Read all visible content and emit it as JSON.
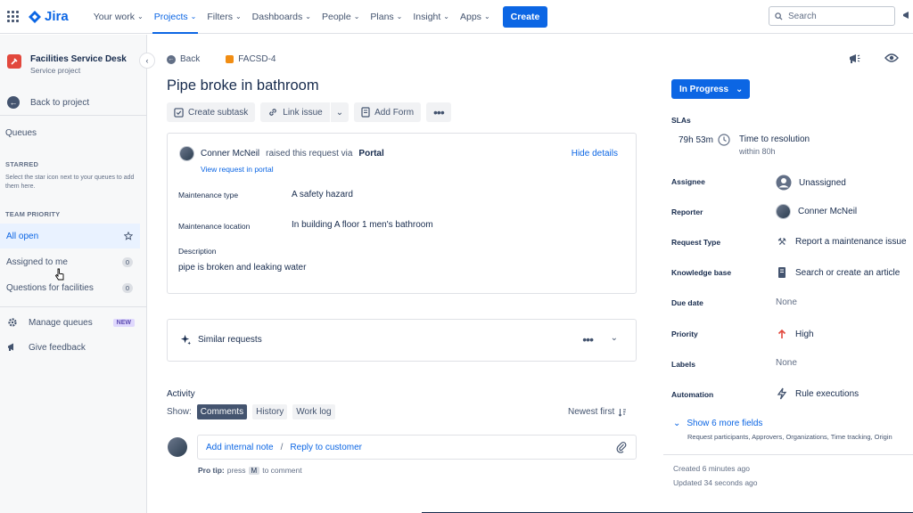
{
  "topnav": {
    "product": "Jira",
    "items": [
      {
        "label": "Your work"
      },
      {
        "label": "Projects"
      },
      {
        "label": "Filters"
      },
      {
        "label": "Dashboards"
      },
      {
        "label": "People"
      },
      {
        "label": "Plans"
      },
      {
        "label": "Insight"
      },
      {
        "label": "Apps"
      }
    ],
    "create_label": "Create",
    "search_placeholder": "Search",
    "accent": "#0c66e4"
  },
  "sidebar": {
    "project_name": "Facilities Service Desk",
    "project_type": "Service project",
    "back_label": "Back to project",
    "queues_title": "Queues",
    "starred_title": "STARRED",
    "starred_hint": "Select the star icon next to your queues to add them here.",
    "team_priority_title": "TEAM PRIORITY",
    "queues": [
      {
        "label": "All open",
        "count": ""
      },
      {
        "label": "Assigned to me",
        "count": "0"
      },
      {
        "label": "Questions for facilities",
        "count": "0"
      }
    ],
    "manage_queues": "Manage queues",
    "new_badge": "NEW",
    "give_feedback": "Give feedback"
  },
  "issue": {
    "back_label": "Back",
    "key": "FACSD-4",
    "title": "Pipe broke in bathroom",
    "actions": {
      "create_subtask": "Create subtask",
      "link_issue": "Link issue",
      "add_form": "Add Form"
    },
    "request": {
      "reporter": "Conner McNeil",
      "raised_text": "raised this request via",
      "channel": "Portal",
      "view_portal": "View request in portal",
      "hide_details": "Hide details"
    },
    "fields": [
      {
        "label": "Maintenance type",
        "value": "A safety hazard"
      },
      {
        "label": "Maintenance location",
        "value": "In building A floor 1 men's bathroom"
      }
    ],
    "description_label": "Description",
    "description": "pipe is broken and leaking water",
    "similar_requests": "Similar requests"
  },
  "activity": {
    "heading": "Activity",
    "show_label": "Show:",
    "tabs": [
      "Comments",
      "History",
      "Work log"
    ],
    "sort_label": "Newest first",
    "add_internal_note": "Add internal note",
    "separator": "/",
    "reply_to_customer": "Reply to customer",
    "protip_label": "Pro tip:",
    "protip_press": "press",
    "protip_key": "M",
    "protip_rest": "to comment"
  },
  "details_panel": {
    "status": "In Progress",
    "slas_label": "SLAs",
    "sla_time": "79h 53m",
    "sla_name": "Time to resolution",
    "sla_within": "within 80h",
    "rows": [
      {
        "label": "Assignee",
        "value": "Unassigned",
        "icon": "user-icon"
      },
      {
        "label": "Reporter",
        "value": "Conner McNeil",
        "icon": "avatar"
      },
      {
        "label": "Request Type",
        "value": "Report a maintenance issue",
        "icon": "tools-icon"
      },
      {
        "label": "Knowledge base",
        "value": "Search or create an article",
        "icon": "book-icon"
      },
      {
        "label": "Due date",
        "value": "None",
        "icon": ""
      },
      {
        "label": "Priority",
        "value": "High",
        "icon": "arrow-up-icon"
      },
      {
        "label": "Labels",
        "value": "None",
        "icon": ""
      },
      {
        "label": "Automation",
        "value": "Rule executions",
        "icon": "lightning-icon"
      }
    ],
    "show_more": "Show 6 more fields",
    "show_more_sub": "Request participants, Approvers, Organizations, Time tracking, Origin",
    "created": "Created 6 minutes ago",
    "updated": "Updated 34 seconds ago",
    "priority_color": "#e2483d"
  }
}
